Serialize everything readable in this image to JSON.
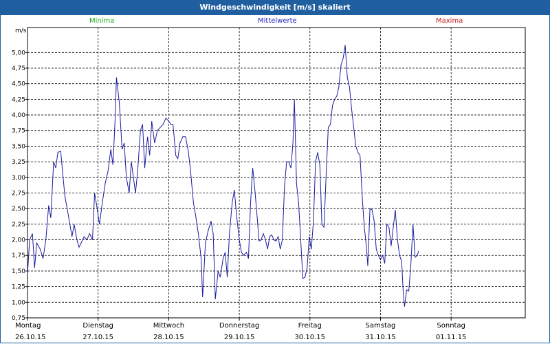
{
  "window": {
    "title": "Windgeschwindigkeit [m/s] skaliert"
  },
  "legend": {
    "min": "Minima",
    "mid": "Mittelwerte",
    "max": "Maxima"
  },
  "colors": {
    "title_bar": "#1f5fa0",
    "series": "#1a1a9e",
    "minima": "#22aa22",
    "mittel": "#2020c0",
    "maxima": "#c02020"
  },
  "chart_data": {
    "type": "line",
    "ylabel": "m/s",
    "ylim": [
      0.75,
      5.4
    ],
    "xlim": [
      0,
      7.05
    ],
    "grid": true,
    "yticks": [
      "0,75",
      "1,00",
      "1,25",
      "1,50",
      "1,75",
      "2,00",
      "2,25",
      "2,50",
      "2,75",
      "3,00",
      "3,25",
      "3,50",
      "3,75",
      "4,00",
      "4,25",
      "4,50",
      "4,75",
      "5,00"
    ],
    "ytick_values": [
      0.75,
      1.0,
      1.25,
      1.5,
      1.75,
      2.0,
      2.25,
      2.5,
      2.75,
      3.0,
      3.25,
      3.5,
      3.75,
      4.0,
      4.25,
      4.5,
      4.75,
      5.0
    ],
    "day_labels": [
      {
        "day": "Montag",
        "date": "26.10.15"
      },
      {
        "day": "Dienstag",
        "date": "27.10.15"
      },
      {
        "day": "Mittwoch",
        "date": "28.10.15"
      },
      {
        "day": "Donnerstag",
        "date": "29.10.15"
      },
      {
        "day": "Freitag",
        "date": "30.10.15"
      },
      {
        "day": "Samstag",
        "date": "31.10.15"
      },
      {
        "day": "Sonntag",
        "date": "01.11.15"
      }
    ],
    "series": [
      {
        "values": [
          [
            0.0,
            1.45
          ],
          [
            0.03,
            2.0
          ],
          [
            0.07,
            2.1
          ],
          [
            0.1,
            1.55
          ],
          [
            0.13,
            1.95
          ],
          [
            0.18,
            1.85
          ],
          [
            0.22,
            1.7
          ],
          [
            0.26,
            2.0
          ],
          [
            0.3,
            2.55
          ],
          [
            0.33,
            2.35
          ],
          [
            0.37,
            3.25
          ],
          [
            0.4,
            3.15
          ],
          [
            0.43,
            3.4
          ],
          [
            0.47,
            3.42
          ],
          [
            0.5,
            3.05
          ],
          [
            0.53,
            2.7
          ],
          [
            0.57,
            2.45
          ],
          [
            0.6,
            2.25
          ],
          [
            0.63,
            2.05
          ],
          [
            0.66,
            2.25
          ],
          [
            0.7,
            2.0
          ],
          [
            0.73,
            1.88
          ],
          [
            0.76,
            1.95
          ],
          [
            0.8,
            2.05
          ],
          [
            0.84,
            2.0
          ],
          [
            0.88,
            2.1
          ],
          [
            0.92,
            2.0
          ],
          [
            0.95,
            2.75
          ],
          [
            0.98,
            2.55
          ],
          [
            1.02,
            2.25
          ],
          [
            1.06,
            2.6
          ],
          [
            1.1,
            2.9
          ],
          [
            1.14,
            3.1
          ],
          [
            1.18,
            3.45
          ],
          [
            1.21,
            3.2
          ],
          [
            1.24,
            3.9
          ],
          [
            1.26,
            4.6
          ],
          [
            1.3,
            4.2
          ],
          [
            1.34,
            3.45
          ],
          [
            1.37,
            3.55
          ],
          [
            1.4,
            3.0
          ],
          [
            1.44,
            2.75
          ],
          [
            1.47,
            3.25
          ],
          [
            1.5,
            3.0
          ],
          [
            1.53,
            2.75
          ],
          [
            1.56,
            3.1
          ],
          [
            1.6,
            3.75
          ],
          [
            1.63,
            3.85
          ],
          [
            1.66,
            3.15
          ],
          [
            1.7,
            3.65
          ],
          [
            1.73,
            3.35
          ],
          [
            1.76,
            3.9
          ],
          [
            1.8,
            3.55
          ],
          [
            1.84,
            3.75
          ],
          [
            1.88,
            3.8
          ],
          [
            1.92,
            3.85
          ],
          [
            1.96,
            3.95
          ],
          [
            2.0,
            3.9
          ],
          [
            2.03,
            3.85
          ],
          [
            2.06,
            3.85
          ],
          [
            2.1,
            3.35
          ],
          [
            2.13,
            3.3
          ],
          [
            2.16,
            3.55
          ],
          [
            2.2,
            3.65
          ],
          [
            2.24,
            3.65
          ],
          [
            2.28,
            3.4
          ],
          [
            2.31,
            3.1
          ],
          [
            2.35,
            2.6
          ],
          [
            2.38,
            2.4
          ],
          [
            2.42,
            2.1
          ],
          [
            2.46,
            1.7
          ],
          [
            2.48,
            1.08
          ],
          [
            2.52,
            1.95
          ],
          [
            2.56,
            2.15
          ],
          [
            2.6,
            2.3
          ],
          [
            2.63,
            2.1
          ],
          [
            2.66,
            1.05
          ],
          [
            2.7,
            1.5
          ],
          [
            2.73,
            1.4
          ],
          [
            2.77,
            1.7
          ],
          [
            2.8,
            1.8
          ],
          [
            2.83,
            1.4
          ],
          [
            2.86,
            2.1
          ],
          [
            2.9,
            2.6
          ],
          [
            2.93,
            2.8
          ],
          [
            2.96,
            2.4
          ],
          [
            3.0,
            2.0
          ],
          [
            3.03,
            1.8
          ],
          [
            3.06,
            1.75
          ],
          [
            3.1,
            1.8
          ],
          [
            3.13,
            1.7
          ],
          [
            3.16,
            2.6
          ],
          [
            3.19,
            3.15
          ],
          [
            3.22,
            2.8
          ],
          [
            3.25,
            2.4
          ],
          [
            3.28,
            1.98
          ],
          [
            3.31,
            2.0
          ],
          [
            3.34,
            2.1
          ],
          [
            3.37,
            2.0
          ],
          [
            3.4,
            1.85
          ],
          [
            3.43,
            2.05
          ],
          [
            3.46,
            2.08
          ],
          [
            3.49,
            2.0
          ],
          [
            3.52,
            1.98
          ],
          [
            3.55,
            2.05
          ],
          [
            3.58,
            1.85
          ],
          [
            3.61,
            2.0
          ],
          [
            3.64,
            2.85
          ],
          [
            3.67,
            3.25
          ],
          [
            3.7,
            3.25
          ],
          [
            3.73,
            3.15
          ],
          [
            3.76,
            3.55
          ],
          [
            3.78,
            4.25
          ],
          [
            3.81,
            2.9
          ],
          [
            3.84,
            2.6
          ],
          [
            3.87,
            2.0
          ],
          [
            3.9,
            1.38
          ],
          [
            3.93,
            1.4
          ],
          [
            3.96,
            1.55
          ],
          [
            3.99,
            2.05
          ],
          [
            4.02,
            1.85
          ],
          [
            4.05,
            2.3
          ],
          [
            4.08,
            3.25
          ],
          [
            4.11,
            3.4
          ],
          [
            4.14,
            3.2
          ],
          [
            4.17,
            2.25
          ],
          [
            4.2,
            2.2
          ],
          [
            4.23,
            3.05
          ],
          [
            4.26,
            3.8
          ],
          [
            4.29,
            3.85
          ],
          [
            4.32,
            4.15
          ],
          [
            4.35,
            4.25
          ],
          [
            4.38,
            4.3
          ],
          [
            4.41,
            4.45
          ],
          [
            4.44,
            4.8
          ],
          [
            4.47,
            4.9
          ],
          [
            4.5,
            5.12
          ],
          [
            4.53,
            4.6
          ],
          [
            4.56,
            4.45
          ],
          [
            4.59,
            4.1
          ],
          [
            4.62,
            3.8
          ],
          [
            4.65,
            3.5
          ],
          [
            4.68,
            3.4
          ],
          [
            4.71,
            3.35
          ],
          [
            4.74,
            2.7
          ],
          [
            4.77,
            2.2
          ],
          [
            4.8,
            1.9
          ],
          [
            4.82,
            1.58
          ],
          [
            4.85,
            2.5
          ],
          [
            4.88,
            2.48
          ],
          [
            4.91,
            2.3
          ],
          [
            4.94,
            1.85
          ],
          [
            4.97,
            1.75
          ],
          [
            5.0,
            1.68
          ],
          [
            5.03,
            1.75
          ],
          [
            5.06,
            1.62
          ],
          [
            5.09,
            2.25
          ],
          [
            5.12,
            2.2
          ],
          [
            5.15,
            1.9
          ],
          [
            5.18,
            2.2
          ],
          [
            5.21,
            2.48
          ],
          [
            5.24,
            2.0
          ],
          [
            5.27,
            1.75
          ],
          [
            5.3,
            1.65
          ],
          [
            5.32,
            1.2
          ],
          [
            5.34,
            0.93
          ],
          [
            5.37,
            1.2
          ],
          [
            5.4,
            1.18
          ],
          [
            5.43,
            1.6
          ],
          [
            5.46,
            2.25
          ],
          [
            5.49,
            1.72
          ],
          [
            5.52,
            1.75
          ],
          [
            5.54,
            1.82
          ]
        ]
      }
    ]
  }
}
